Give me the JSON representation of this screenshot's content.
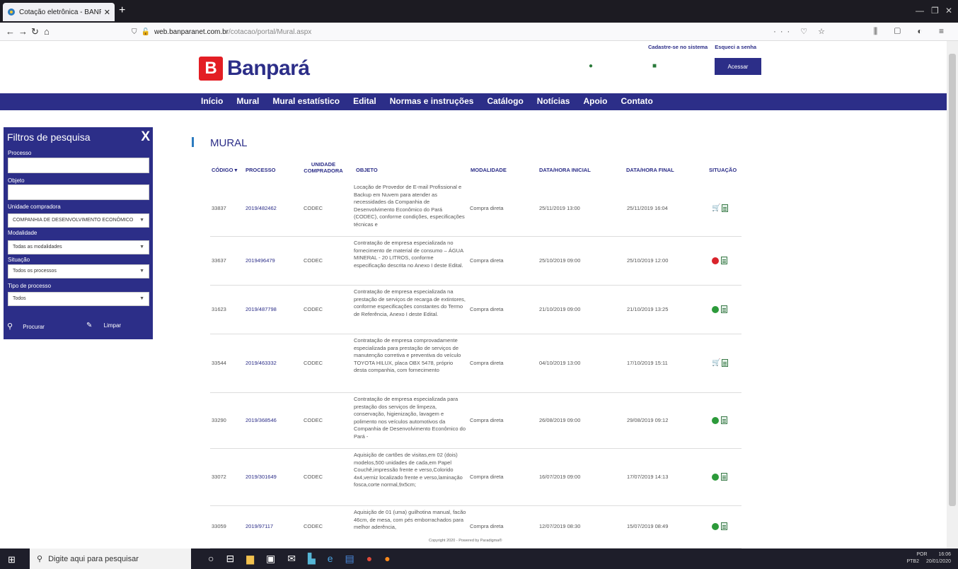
{
  "browser": {
    "tab_title": "Cotação eletrônica - BANPARÁ",
    "tab_close": "✕",
    "new_tab": "+",
    "url_host": "web.banparanet.com.br",
    "url_path": "/cotacao/portal/Mural.aspx",
    "url_icons": "··· ♡ ☆",
    "right_icons": "⫼ ▢ ◐ ≡"
  },
  "header": {
    "logo_text": "Banpará",
    "link_register": "Cadastre-se no sistema",
    "link_forgot": "Esqueci a senha",
    "login_button": "Acessar"
  },
  "nav": {
    "items": [
      "Início",
      "Mural",
      "Mural estatístico",
      "Edital",
      "Normas e instruções",
      "Catálogo",
      "Notícias",
      "Apoio",
      "Contato"
    ]
  },
  "sidebar": {
    "title": "Filtros de pesquisa",
    "close": "X",
    "label_processo": "Processo",
    "label_objeto": "Objeto",
    "label_unidade": "Unidade compradora",
    "value_unidade": "COMPANHIA DE DESENVOLVIMENTO ECONÔMICO",
    "label_modalidade": "Modalidade",
    "value_modalidade": "Todas as modalidades",
    "label_situacao": "Situação",
    "value_situacao": "Todos os processos",
    "label_tipo": "Tipo de processo",
    "value_tipo": "Todos",
    "btn_search": "Procurar",
    "btn_clear": "Limpar"
  },
  "main": {
    "title": "MURAL",
    "columns": {
      "codigo": "CÓDIGO ▾",
      "processo": "PROCESSO",
      "unidade": "UNIDADE COMPRADORA",
      "objeto": "OBJETO",
      "modalidade": "MODALIDADE",
      "inicio": "DATA/HORA INICIAL",
      "fim": "DATA/HORA FINAL",
      "situacao": "SITUAÇÃO"
    },
    "rows": [
      {
        "codigo": "33837",
        "processo": "2019/482462",
        "unidade": "CODEC",
        "objeto": "Locação de Provedor de E-mail Profissional e Backup em Nuvem para atender as necessidades da Companhia de Desenvolvimento Econômico do Pará (CODEC), conforme condições, especificações técnicas e",
        "modalidade": "Compra direta",
        "inicio": "25/11/2019 13:00",
        "fim": "25/11/2019 16:04",
        "status_icon": "cart-icon"
      },
      {
        "codigo": "33637",
        "processo": "2019496479",
        "unidade": "CODEC",
        "objeto": "Contratação de empresa especializada no fornecimento de material de consumo – ÁGUA MINERAL - 20 LITROS, conforme especificação descrita no Anexo I deste Edital.",
        "modalidade": "Compra direta",
        "inicio": "25/10/2019 09:00",
        "fim": "25/10/2019 12:00",
        "status_icon": "cancel-icon"
      },
      {
        "codigo": "31623",
        "processo": "2019/487798",
        "unidade": "CODEC",
        "objeto": "Contratação de empresa especializada na prestação de serviços de recarga de extintores, conforme especificações constantes do Termo de Referência, Anexo I deste Edital.",
        "modalidade": "Compra direta",
        "inicio": "21/10/2019 09:00",
        "fim": "21/10/2019 13:25",
        "status_icon": "check-icon"
      },
      {
        "codigo": "33544",
        "processo": "2019/463332",
        "unidade": "CODEC",
        "objeto": "Contratação de empresa comprovadamente especializada para prestação de serviços de manutenção corretiva e preventiva do veículo TOYOTA HILUX, placa OBX 5478, próprio desta companhia, com fornecimento",
        "modalidade": "Compra direta",
        "inicio": "04/10/2019 13:00",
        "fim": "17/10/2019 15:11",
        "status_icon": "cart-icon"
      },
      {
        "codigo": "33290",
        "processo": "2019/368546",
        "unidade": "CODEC",
        "objeto": "Contratação de empresa especializada para prestação dos serviços de limpeza, conservação, higienização, lavagem e polimento nos veículos automotivos da Companhia de Desenvolvimento Econômico do Pará -",
        "modalidade": "Compra direta",
        "inicio": "26/08/2019 09:00",
        "fim": "29/08/2019 09:12",
        "status_icon": "check-icon"
      },
      {
        "codigo": "33072",
        "processo": "2019/301649",
        "unidade": "CODEC",
        "objeto": "Aquisição de cartões de visitas,em 02 (dois) modelos,500 unidades de cada,em Papel Couchê,impressão frente e verso,Colorido 4x4,verniz localizado frente e verso,laminação fosca,corte normal,9x5cm;",
        "modalidade": "Compra direta",
        "inicio": "16/07/2019 09:00",
        "fim": "17/07/2019 14:13",
        "status_icon": "check-icon"
      },
      {
        "codigo": "33059",
        "processo": "2019/97117",
        "unidade": "CODEC",
        "objeto": "Aquisição de 01 (uma) guilhotina manual, facão 46cm, de mesa, com pés emborrachados para melhor aderência,",
        "modalidade": "Compra direta",
        "inicio": "12/07/2019 08:30",
        "fim": "15/07/2019 08:49",
        "status_icon": "check-icon"
      }
    ],
    "copyright": "Copyright 2020 - Powered by Paradigma®"
  },
  "taskbar": {
    "search_placeholder": "Digite aqui para pesquisar",
    "lang": "POR",
    "layout": "PTB2",
    "time": "16:06",
    "date": "20/01/2020"
  }
}
